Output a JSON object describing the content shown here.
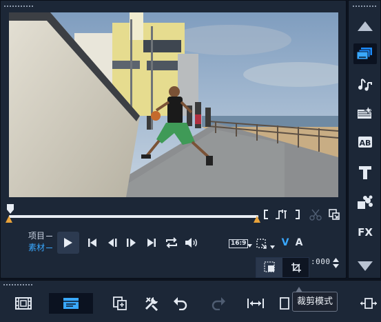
{
  "player": {
    "mode_project": "项目",
    "mode_clip": "素材",
    "active_mode": "clip",
    "aspect_label": "16:9",
    "video_track_label": "V",
    "audio_track_label": "A",
    "timecode": ":000",
    "preview_alt": "video frame"
  },
  "tooltip": {
    "text": "裁剪模式"
  },
  "sidebar": {
    "items": [
      {
        "icon": "scroll-up-icon"
      },
      {
        "icon": "media-library-icon",
        "active": true
      },
      {
        "icon": "audio-icon"
      },
      {
        "icon": "transition-icon"
      },
      {
        "icon": "title-ab-icon",
        "label": "AB"
      },
      {
        "icon": "text-icon",
        "label": "T"
      },
      {
        "icon": "graphics-icon"
      },
      {
        "icon": "fx-icon",
        "label": "FX"
      },
      {
        "icon": "scroll-down-icon"
      }
    ]
  },
  "colors": {
    "accent": "#39a8ff",
    "panel": "#1c2737",
    "background": "#0c1320",
    "playhead_marker": "#e8a23a"
  }
}
